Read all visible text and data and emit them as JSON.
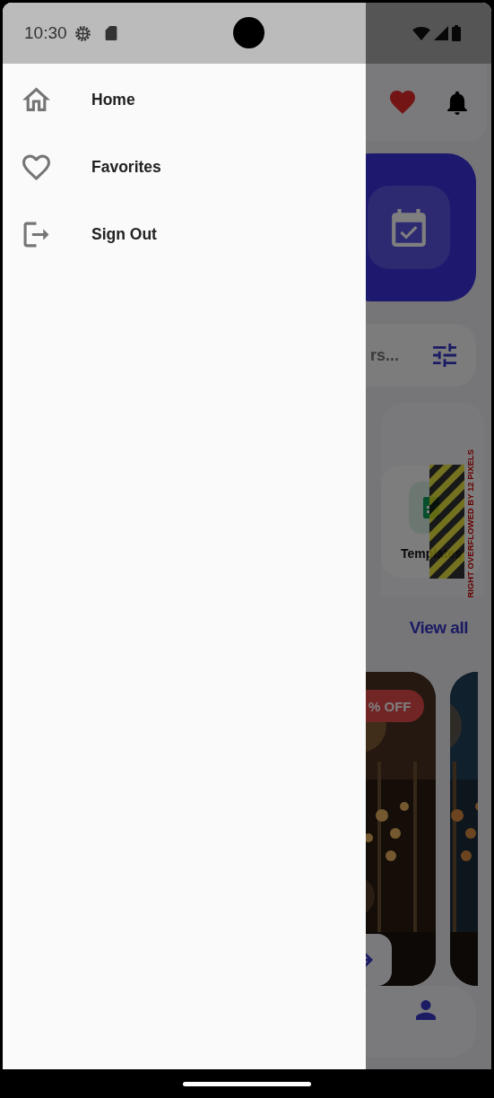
{
  "status_bar": {
    "time": "10:30"
  },
  "drawer": {
    "items": [
      {
        "kind": "home",
        "label": "Home"
      },
      {
        "kind": "favorite",
        "label": "Favorites"
      },
      {
        "kind": "logout",
        "label": "Sign Out"
      }
    ]
  },
  "background_screen": {
    "search_placeholder": "rs...",
    "category": {
      "label": "Templates"
    },
    "overflow_warning": "RIGHT OVERFLOWED BY 12 PIXELS",
    "section_link": "View all",
    "offer_badge": "% OFF"
  }
}
